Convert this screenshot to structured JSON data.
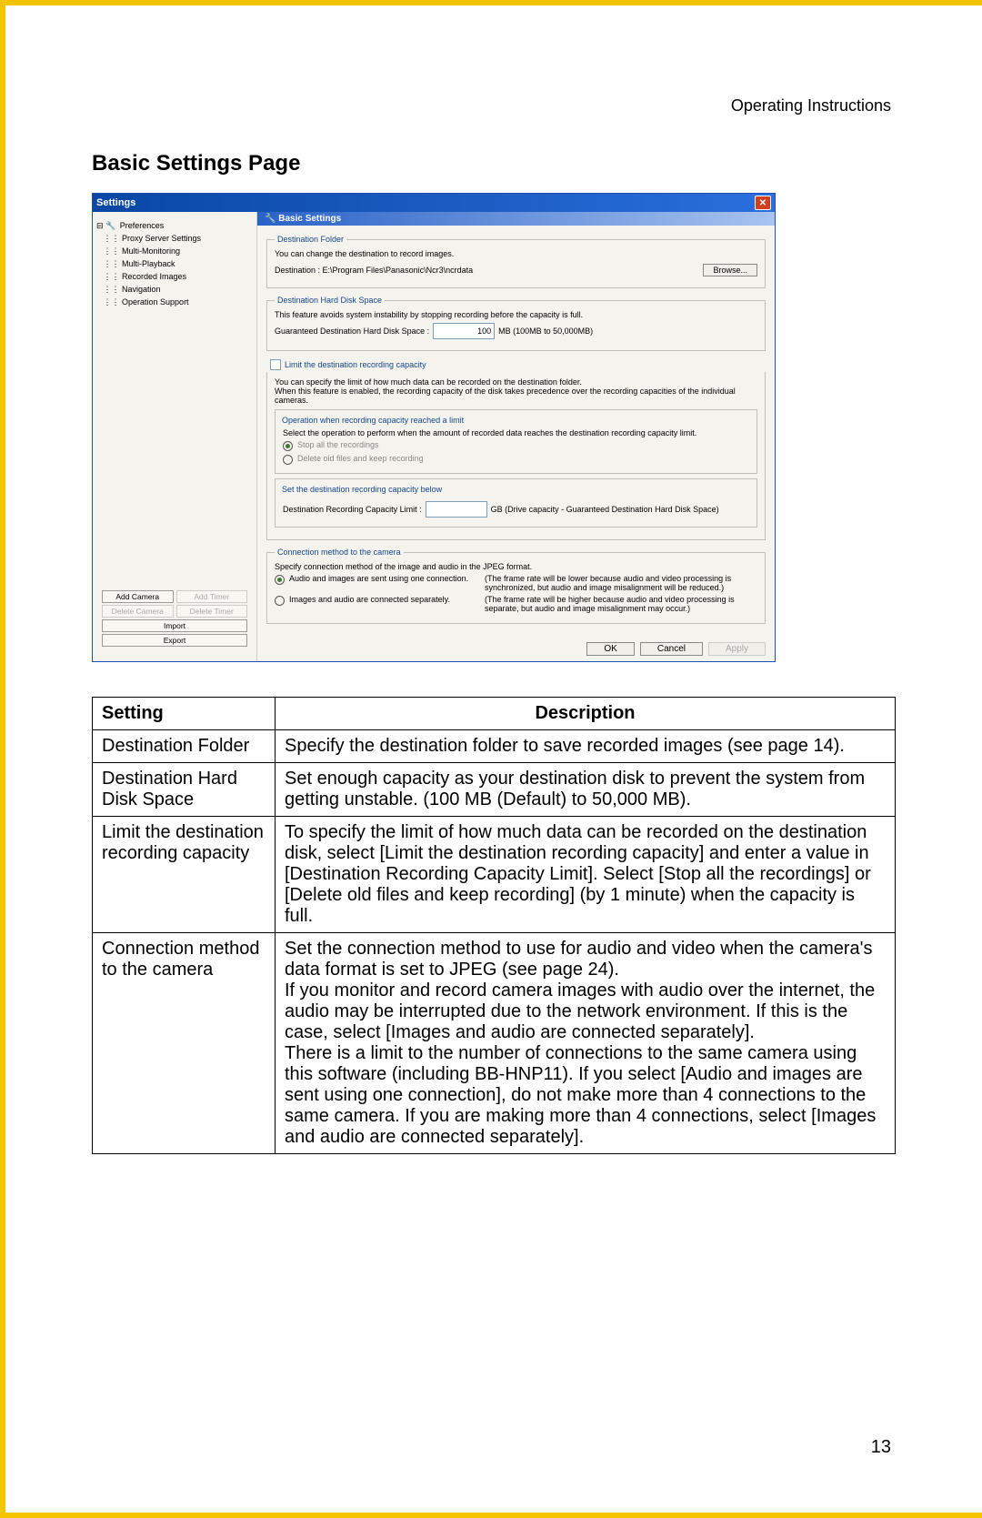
{
  "doc_header": "Operating Instructions",
  "section_title": "Basic Settings Page",
  "page_number": "13",
  "window": {
    "title": "Settings",
    "header": "Basic Settings",
    "tree": {
      "root": "Preferences",
      "items": [
        "Proxy Server Settings",
        "Multi-Monitoring",
        "Multi-Playback",
        "Recorded Images",
        "Navigation",
        "Operation Support"
      ]
    },
    "tree_buttons": {
      "add_camera": "Add Camera",
      "add_timer": "Add Timer",
      "delete_camera": "Delete Camera",
      "delete_timer": "Delete Timer",
      "import": "Import",
      "export": "Export"
    },
    "dest_folder": {
      "legend": "Destination Folder",
      "line1": "You can change the destination to record images.",
      "line2": "Destination : E:\\Program Files\\Panasonic\\Ncr3\\ncrdata",
      "browse": "Browse..."
    },
    "hd_space": {
      "legend": "Destination Hard Disk Space",
      "line1": "This feature avoids system instability by stopping recording before the capacity is full.",
      "label": "Guaranteed Destination Hard Disk Space :",
      "value": "100",
      "unit": "MB  (100MB to 50,000MB)"
    },
    "limit": {
      "legend_chk": "Limit the destination recording capacity",
      "desc": "You can specify the limit of how much data can be recorded on the destination folder.\nWhen this feature is enabled, the recording capacity of the disk takes precedence over the recording capacities of the individual cameras.",
      "op_legend": "Operation when recording capacity reached a limit",
      "op_desc": "Select the operation to perform when the amount of recorded data reaches the destination recording capacity limit.",
      "op_r1": "Stop all the recordings",
      "op_r2": "Delete old files and keep recording",
      "cap_legend": "Set the destination recording capacity below",
      "cap_label": "Destination Recording Capacity Limit :",
      "cap_unit": "GB  (Drive capacity - Guaranteed Destination Hard Disk Space)"
    },
    "conn": {
      "legend": "Connection method to the camera",
      "desc": "Specify connection method of the image and audio in the JPEG format.",
      "r1_label": "Audio and images are sent using one connection.",
      "r1_note": "(The frame rate will be lower because audio and video processing is synchronized, but audio and image misalignment will be reduced.)",
      "r2_label": "Images and audio are connected separately.",
      "r2_note": "(The frame rate will be higher because audio and video processing is separate, but audio and image misalignment may occur.)"
    },
    "footer": {
      "ok": "OK",
      "cancel": "Cancel",
      "apply": "Apply"
    }
  },
  "table": {
    "h1": "Setting",
    "h2": "Description",
    "rows": [
      {
        "setting": "Destination Folder",
        "desc": "Specify the destination folder to save recorded images (see page 14)."
      },
      {
        "setting": "Destination Hard Disk Space",
        "desc": "Set enough capacity as your destination disk to prevent the system from getting unstable. (100 MB (Default) to 50,000 MB)."
      },
      {
        "setting": "Limit the destination recording capacity",
        "desc": "To specify the limit of how much data can be recorded on the destination disk, select [Limit the destination recording capacity] and enter a value in [Destination Recording Capacity Limit]. Select [Stop all the recordings] or [Delete old files and keep recording] (by 1 minute) when the capacity is full."
      },
      {
        "setting": "Connection method to the camera",
        "desc": "Set the connection method to use for audio and video when the camera's data format is set to JPEG (see page 24).\nIf you monitor and record camera images with audio over the internet, the audio may be interrupted due to the network environment. If this is the case, select [Images and audio are connected separately].\nThere is a limit to the number of connections to the same camera using this software (including BB-HNP11). If you select [Audio and images are sent using one connection], do not make more than 4 connections to the same camera. If you are making more than 4 connections, select [Images and audio are connected separately]."
      }
    ]
  }
}
